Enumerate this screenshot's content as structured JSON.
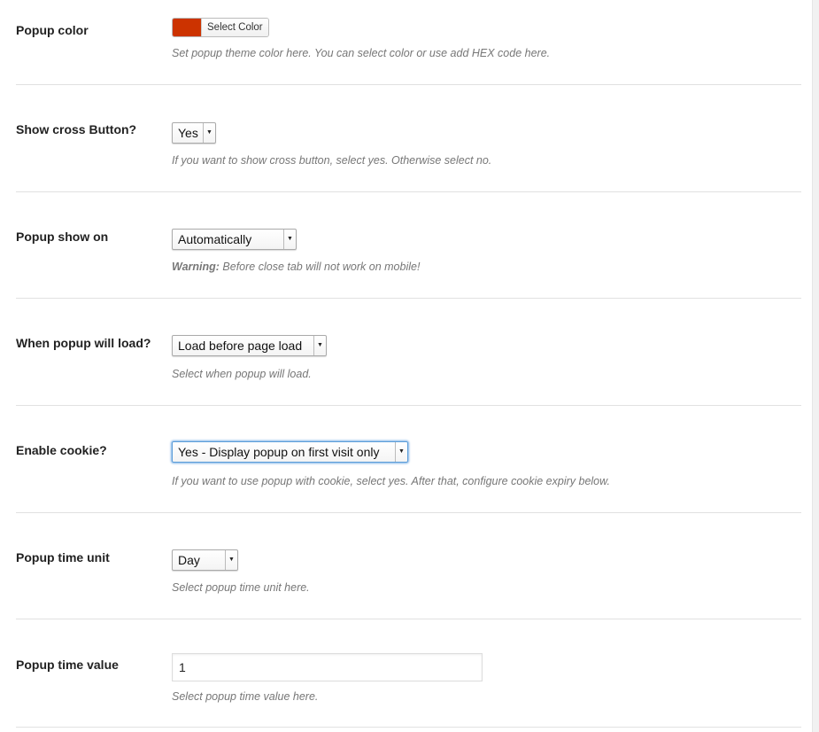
{
  "rows": {
    "popup_color": {
      "label": "Popup color",
      "button_label": "Select Color",
      "swatch_color": "#cc3300",
      "description": "Set popup theme color here. You can select color or use add HEX code here."
    },
    "show_cross": {
      "label": "Show cross Button?",
      "value": "Yes",
      "description": "If you want to show cross button, select yes. Otherwise select no."
    },
    "show_on": {
      "label": "Popup show on",
      "value": "Automatically",
      "description_prefix": "Warning:",
      "description": " Before close tab will not work on mobile!"
    },
    "load_time": {
      "label": "When popup will load?",
      "value": "Load before page load",
      "description": "Select when popup will load."
    },
    "cookie": {
      "label": "Enable cookie?",
      "value": "Yes - Display popup on first visit only",
      "description": "If you want to use popup with cookie, select yes. After that, configure cookie expiry below."
    },
    "time_unit": {
      "label": "Popup time unit",
      "value": "Day",
      "description": "Select popup time unit here."
    },
    "time_value": {
      "label": "Popup time value",
      "value": "1",
      "description": "Select popup time value here."
    }
  },
  "icons": {
    "dropdown_arrow": "chevron-down-icon"
  }
}
